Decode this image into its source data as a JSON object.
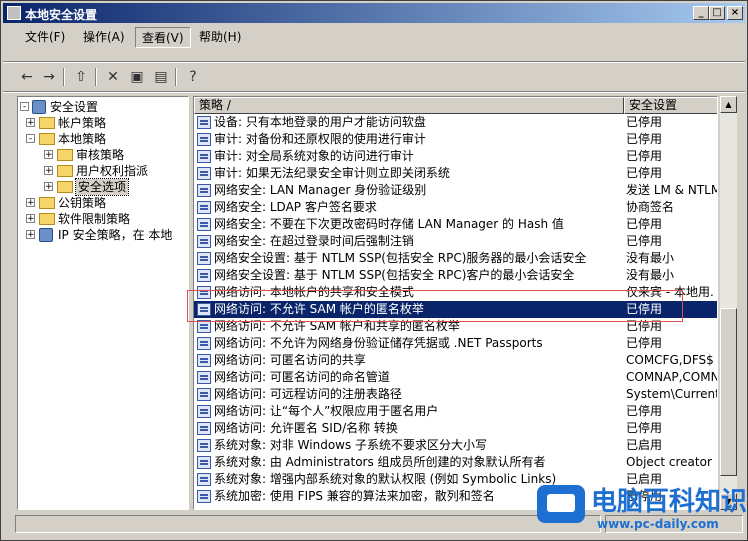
{
  "window": {
    "title": "本地安全设置"
  },
  "titlebar_buttons": [
    "_",
    "□",
    "×"
  ],
  "menu": [
    {
      "label": "文件(F)"
    },
    {
      "label": "操作(A)"
    },
    {
      "label": "查看(V)"
    },
    {
      "label": "帮助(H)"
    }
  ],
  "toolbar": {
    "icons": [
      "back-icon",
      "forward-icon",
      "up-folder-icon",
      "delete-icon",
      "properties-icon",
      "export-list-icon",
      "help-icon"
    ]
  },
  "tree": {
    "items": [
      {
        "label": "安全设置",
        "icon": "shield-icon",
        "expander": "-"
      },
      {
        "label": "帐户策略",
        "icon": "folder-icon",
        "expander": "+"
      },
      {
        "label": "本地策略",
        "icon": "folder-open-icon",
        "expander": "-"
      },
      {
        "label": "审核策略",
        "icon": "folder-icon",
        "expander": "+"
      },
      {
        "label": "用户权利指派",
        "icon": "folder-icon",
        "expander": "+"
      },
      {
        "label": "安全选项",
        "icon": "folder-icon",
        "expander": "+"
      },
      {
        "label": "公钥策略",
        "icon": "folder-icon",
        "expander": "+"
      },
      {
        "label": "软件限制策略",
        "icon": "folder-icon",
        "expander": "+"
      },
      {
        "label": "IP 安全策略，在 本地",
        "icon": "network-icon",
        "expander": "+"
      }
    ]
  },
  "list": {
    "columns": [
      "策略 /",
      "安全设置"
    ],
    "rows": [
      {
        "policy": "设备: 只有本地登录的用户才能访问软盘",
        "setting": "已停用"
      },
      {
        "policy": "审计: 对备份和还原权限的使用进行审计",
        "setting": "已停用"
      },
      {
        "policy": "审计: 对全局系统对象的访问进行审计",
        "setting": "已停用"
      },
      {
        "policy": "审计: 如果无法纪录安全审计则立即关闭系统",
        "setting": "已停用"
      },
      {
        "policy": "网络安全: LAN Manager 身份验证级别",
        "setting": "发送 LM & NTLM ."
      },
      {
        "policy": "网络安全: LDAP 客户签名要求",
        "setting": "协商签名"
      },
      {
        "policy": "网络安全: 不要在下次更改密码时存储 LAN Manager 的 Hash 值",
        "setting": "已停用"
      },
      {
        "policy": "网络安全: 在超过登录时间后强制注销",
        "setting": "已停用"
      },
      {
        "policy": "网络安全设置: 基于 NTLM SSP(包括安全 RPC)服务器的最小会话安全",
        "setting": "没有最小"
      },
      {
        "policy": "网络安全设置: 基于 NTLM SSP(包括安全 RPC)客户的最小会话安全",
        "setting": "没有最小"
      },
      {
        "policy": "网络访问: 本地帐户的共享和安全模式",
        "setting": "仅来宾 - 本地用."
      },
      {
        "policy": "网络访问: 不允许 SAM 帐户的匿名枚举",
        "setting": "已停用",
        "selected": true
      },
      {
        "policy": "网络访问: 不允许 SAM 帐户和共享的匿名枚举",
        "setting": "已停用"
      },
      {
        "policy": "网络访问: 不允许为网络身份验证储存凭据或 .NET Passports",
        "setting": "已停用"
      },
      {
        "policy": "网络访问: 可匿名访问的共享",
        "setting": "COMCFG,DFS$"
      },
      {
        "policy": "网络访问: 可匿名访问的命名管道",
        "setting": "COMNAP,COMNODE,."
      },
      {
        "policy": "网络访问: 可远程访问的注册表路径",
        "setting": "System\\CurrentC."
      },
      {
        "policy": "网络访问: 让“每个人”权限应用于匿名用户",
        "setting": "已停用"
      },
      {
        "policy": "网络访问: 允许匿名 SID/名称 转换",
        "setting": "已停用"
      },
      {
        "policy": "系统对象: 对非 Windows 子系统不要求区分大小写",
        "setting": "已启用"
      },
      {
        "policy": "系统对象: 由 Administrators 组成员所创建的对象默认所有者",
        "setting": "Object creator"
      },
      {
        "policy": "系统对象: 增强内部系统对象的默认权限 (例如 Symbolic Links)",
        "setting": "已启用"
      },
      {
        "policy": "系统加密: 使用 FIPS 兼容的算法来加密，散列和签名",
        "setting": "已停用"
      }
    ]
  },
  "watermark": {
    "title": "电脑百科知识",
    "url": "www.pc-daily.com"
  }
}
